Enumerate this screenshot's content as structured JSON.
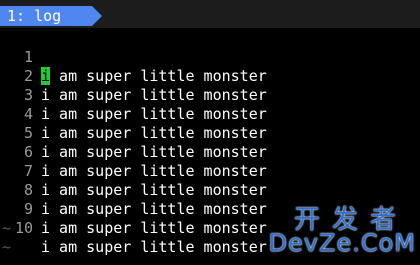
{
  "tabline": {
    "tab_label": "1: log",
    "tab_color": "#4f86f0"
  },
  "buffer": {
    "lines": [
      {
        "num": "1",
        "text": "i am super little monster",
        "cursor": true
      },
      {
        "num": "2",
        "text": "i am super little monster"
      },
      {
        "num": "3",
        "text": "i am super little monster"
      },
      {
        "num": "4",
        "text": "i am super little monster"
      },
      {
        "num": "5",
        "text": "i am super little monster"
      },
      {
        "num": "6",
        "text": "i am super little monster"
      },
      {
        "num": "7",
        "text": "i am super little monster"
      },
      {
        "num": "8",
        "text": "i am super little monster"
      },
      {
        "num": "9",
        "text": "i am super little monster"
      },
      {
        "num": "10",
        "text": "i am super little monster"
      }
    ],
    "empty_marker": "~",
    "cursor_color": "#22cc33"
  },
  "watermark": {
    "top": "开发者",
    "bottom": "DevZe.CoM"
  }
}
